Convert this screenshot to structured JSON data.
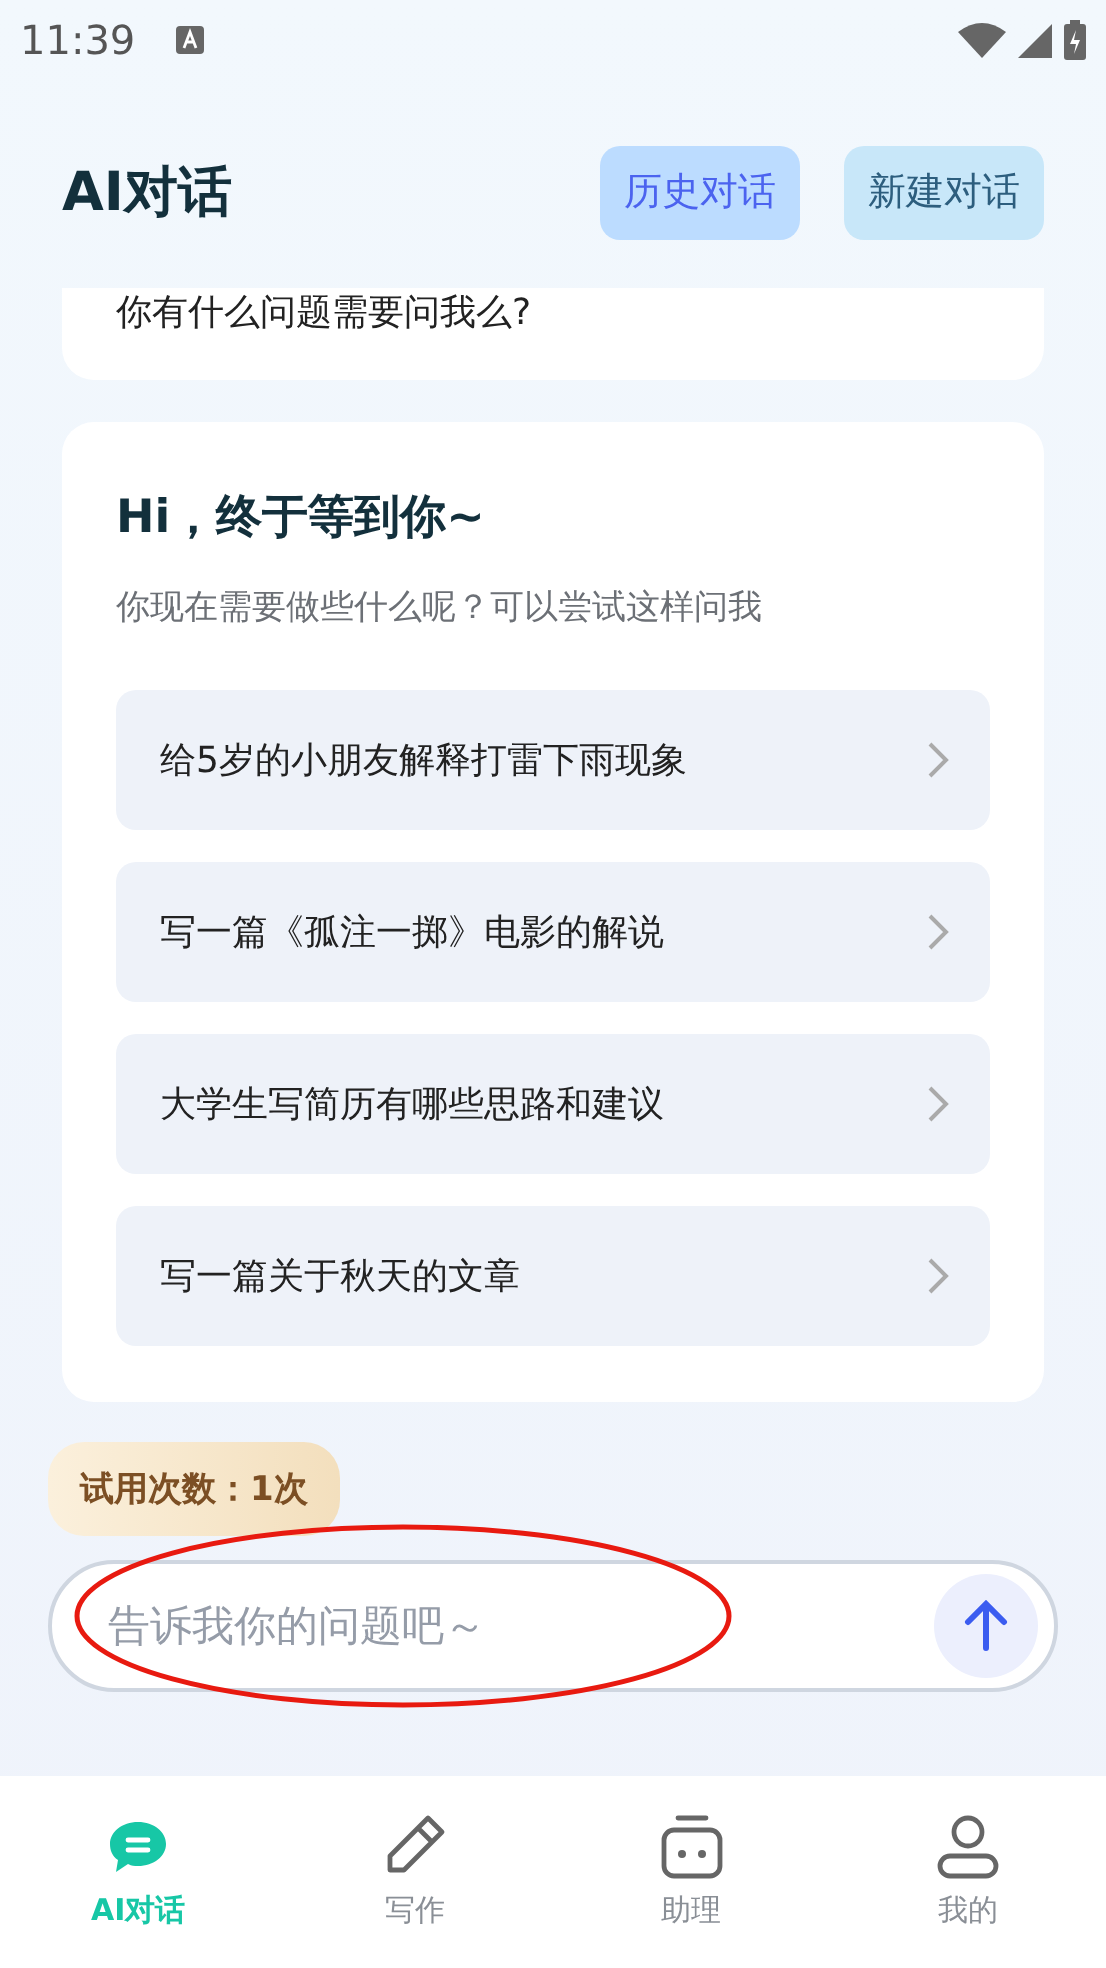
{
  "status_bar": {
    "time": "11:39"
  },
  "header": {
    "title": "AI对话",
    "buttons": [
      {
        "label": "历史对话",
        "kind": "history"
      },
      {
        "label": "新建对话",
        "kind": "new"
      }
    ]
  },
  "previous_message": {
    "text": "你有什么问题需要问我么?"
  },
  "welcome": {
    "title": "Hi，终于等到你~",
    "subtitle": "你现在需要做些什么呢？可以尝试这样问我",
    "suggestions": [
      {
        "text": "给5岁的小朋友解释打雷下雨现象"
      },
      {
        "text": "写一篇《孤注一掷》电影的解说"
      },
      {
        "text": "大学生写简历有哪些思路和建议"
      },
      {
        "text": "写一篇关于秋天的文章"
      }
    ]
  },
  "trial_badge": {
    "text": "试用次数：1次"
  },
  "input": {
    "placeholder": "告诉我你的问题吧～"
  },
  "annotation": {
    "kind": "ellipse"
  },
  "nav": [
    {
      "label": "AI对话",
      "kind": "chat",
      "selected": true
    },
    {
      "label": "写作",
      "kind": "pencil",
      "selected": false
    },
    {
      "label": "助理",
      "kind": "robot",
      "selected": false
    },
    {
      "label": "我的",
      "kind": "person",
      "selected": false
    }
  ]
}
